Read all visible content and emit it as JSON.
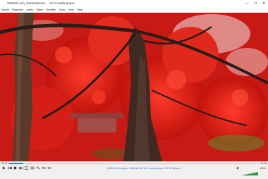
{
  "window": {
    "title": "VMHub.com_GamesBourn.. - VLC media player",
    "minimize_glyph": "—",
    "maximize_glyph": "☐",
    "close_glyph": "✕"
  },
  "menu": {
    "items": [
      "Media",
      "Playback",
      "Audio",
      "Video",
      "Subtitle",
      "Tools",
      "View",
      "Help"
    ]
  },
  "player": {
    "current_time": "00:16",
    "total_time": "04:08",
    "progress": 0.06,
    "status": "VMHub file capture VMHub.IAH VLC media player 3.0.18 Vetinari",
    "volume_label": "100%",
    "volume_level": 1.0,
    "accent": "#1e88e5",
    "status_color": "#3a6fb0"
  },
  "icons": {
    "app": "vlc-cone-icon",
    "play": "play-icon",
    "prev": "previous-icon",
    "stop": "stop-icon",
    "next": "next-icon",
    "fullscreen": "fullscreen-icon",
    "extended": "extended-settings-icon",
    "playlist": "playlist-icon",
    "loop": "loop-icon",
    "shuffle": "shuffle-icon",
    "volume": "speaker-icon"
  }
}
